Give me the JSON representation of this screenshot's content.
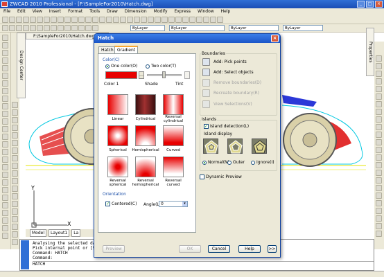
{
  "app": {
    "title": "ZWCAD 2010 Professional - [F:\\SampleFor2010\\Hatch.dwg]"
  },
  "menu": [
    "File",
    "Edit",
    "View",
    "Insert",
    "Format",
    "Tools",
    "Draw",
    "Dimension",
    "Modify",
    "Express",
    "Window",
    "Help"
  ],
  "toolbar": {
    "layer_combo": "ByLayer",
    "linetype_combo": "ByLayer",
    "lineweight_combo": "ByLayer",
    "color_combo": "ByLayer"
  },
  "doc_tab": "F:\\SampleFor2010\\Hatch.dwg",
  "side_panels": {
    "design_center": "Design Center",
    "properties": "Properties"
  },
  "axis": {
    "y": "Y",
    "x": "X"
  },
  "layout_tabs": [
    "Model",
    "Layout1",
    "La"
  ],
  "command": {
    "lines": [
      "Analysing the selected da",
      "Pick internal point or [Se",
      "Command: HATCH",
      "Command:"
    ],
    "input": "HATCH"
  },
  "dialog": {
    "title": "Hatch",
    "close": "×",
    "tabs": [
      "Hatch",
      "Gradient"
    ],
    "color_section": "Color(C)",
    "one_color": "One color(O)",
    "two_color": "Two color(T)",
    "color1_label": "Color 1",
    "shade_label": "Shade",
    "tint_label": "Tint",
    "color1_value": "#e80000",
    "gradients": [
      {
        "label": "Linear"
      },
      {
        "label": "Cylindrical"
      },
      {
        "label": "Reversal cylindrical"
      },
      {
        "label": "Spherical"
      },
      {
        "label": "Hemispherical"
      },
      {
        "label": "Curved"
      },
      {
        "label": "Reversal spherical"
      },
      {
        "label": "Reversal hemispherical"
      },
      {
        "label": "Reversal curved"
      }
    ],
    "orientation_section": "Orientation",
    "centered": "Centered(C)",
    "angle_label": "Angle(L)",
    "angle_value": "0",
    "boundaries_section": "Boundaries",
    "add_pick": "Add: Pick points",
    "add_select": "Add: Select objects",
    "remove_boundaries": "Remove boundaries(D)",
    "recreate_boundary": "Recreate boundary(R)",
    "view_selections": "View Selections(V)",
    "islands_section": "Islands",
    "island_detection": "Island detection(L)",
    "island_display": "Island display",
    "normal": "Normal(N)",
    "outer": "Outer",
    "ignore": "Ignore(I)",
    "dynamic_preview": "Dynamic Preview",
    "preview_button": "Preview",
    "ok_button": "OK",
    "cancel_button": "Cancel",
    "help_button": "Help",
    "more_button": ">>"
  }
}
